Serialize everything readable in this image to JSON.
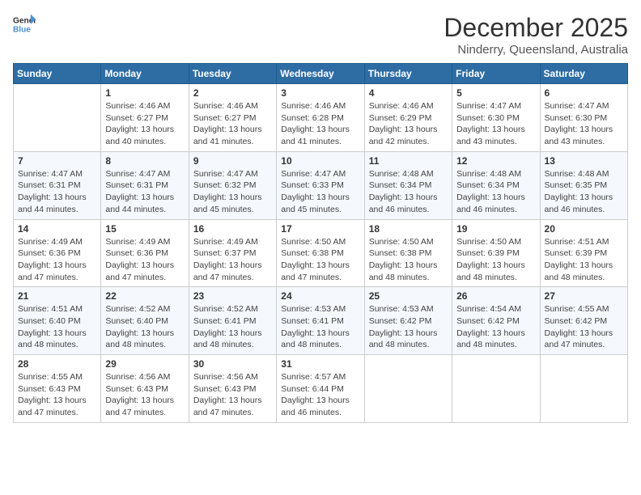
{
  "logo": {
    "text_general": "General",
    "text_blue": "Blue"
  },
  "header": {
    "title": "December 2025",
    "subtitle": "Ninderry, Queensland, Australia"
  },
  "weekdays": [
    "Sunday",
    "Monday",
    "Tuesday",
    "Wednesday",
    "Thursday",
    "Friday",
    "Saturday"
  ],
  "weeks": [
    [
      {
        "day": "",
        "sunrise": "",
        "sunset": "",
        "daylight": ""
      },
      {
        "day": "1",
        "sunrise": "Sunrise: 4:46 AM",
        "sunset": "Sunset: 6:27 PM",
        "daylight": "Daylight: 13 hours and 40 minutes."
      },
      {
        "day": "2",
        "sunrise": "Sunrise: 4:46 AM",
        "sunset": "Sunset: 6:27 PM",
        "daylight": "Daylight: 13 hours and 41 minutes."
      },
      {
        "day": "3",
        "sunrise": "Sunrise: 4:46 AM",
        "sunset": "Sunset: 6:28 PM",
        "daylight": "Daylight: 13 hours and 41 minutes."
      },
      {
        "day": "4",
        "sunrise": "Sunrise: 4:46 AM",
        "sunset": "Sunset: 6:29 PM",
        "daylight": "Daylight: 13 hours and 42 minutes."
      },
      {
        "day": "5",
        "sunrise": "Sunrise: 4:47 AM",
        "sunset": "Sunset: 6:30 PM",
        "daylight": "Daylight: 13 hours and 43 minutes."
      },
      {
        "day": "6",
        "sunrise": "Sunrise: 4:47 AM",
        "sunset": "Sunset: 6:30 PM",
        "daylight": "Daylight: 13 hours and 43 minutes."
      }
    ],
    [
      {
        "day": "7",
        "sunrise": "Sunrise: 4:47 AM",
        "sunset": "Sunset: 6:31 PM",
        "daylight": "Daylight: 13 hours and 44 minutes."
      },
      {
        "day": "8",
        "sunrise": "Sunrise: 4:47 AM",
        "sunset": "Sunset: 6:31 PM",
        "daylight": "Daylight: 13 hours and 44 minutes."
      },
      {
        "day": "9",
        "sunrise": "Sunrise: 4:47 AM",
        "sunset": "Sunset: 6:32 PM",
        "daylight": "Daylight: 13 hours and 45 minutes."
      },
      {
        "day": "10",
        "sunrise": "Sunrise: 4:47 AM",
        "sunset": "Sunset: 6:33 PM",
        "daylight": "Daylight: 13 hours and 45 minutes."
      },
      {
        "day": "11",
        "sunrise": "Sunrise: 4:48 AM",
        "sunset": "Sunset: 6:34 PM",
        "daylight": "Daylight: 13 hours and 46 minutes."
      },
      {
        "day": "12",
        "sunrise": "Sunrise: 4:48 AM",
        "sunset": "Sunset: 6:34 PM",
        "daylight": "Daylight: 13 hours and 46 minutes."
      },
      {
        "day": "13",
        "sunrise": "Sunrise: 4:48 AM",
        "sunset": "Sunset: 6:35 PM",
        "daylight": "Daylight: 13 hours and 46 minutes."
      }
    ],
    [
      {
        "day": "14",
        "sunrise": "Sunrise: 4:49 AM",
        "sunset": "Sunset: 6:36 PM",
        "daylight": "Daylight: 13 hours and 47 minutes."
      },
      {
        "day": "15",
        "sunrise": "Sunrise: 4:49 AM",
        "sunset": "Sunset: 6:36 PM",
        "daylight": "Daylight: 13 hours and 47 minutes."
      },
      {
        "day": "16",
        "sunrise": "Sunrise: 4:49 AM",
        "sunset": "Sunset: 6:37 PM",
        "daylight": "Daylight: 13 hours and 47 minutes."
      },
      {
        "day": "17",
        "sunrise": "Sunrise: 4:50 AM",
        "sunset": "Sunset: 6:38 PM",
        "daylight": "Daylight: 13 hours and 47 minutes."
      },
      {
        "day": "18",
        "sunrise": "Sunrise: 4:50 AM",
        "sunset": "Sunset: 6:38 PM",
        "daylight": "Daylight: 13 hours and 48 minutes."
      },
      {
        "day": "19",
        "sunrise": "Sunrise: 4:50 AM",
        "sunset": "Sunset: 6:39 PM",
        "daylight": "Daylight: 13 hours and 48 minutes."
      },
      {
        "day": "20",
        "sunrise": "Sunrise: 4:51 AM",
        "sunset": "Sunset: 6:39 PM",
        "daylight": "Daylight: 13 hours and 48 minutes."
      }
    ],
    [
      {
        "day": "21",
        "sunrise": "Sunrise: 4:51 AM",
        "sunset": "Sunset: 6:40 PM",
        "daylight": "Daylight: 13 hours and 48 minutes."
      },
      {
        "day": "22",
        "sunrise": "Sunrise: 4:52 AM",
        "sunset": "Sunset: 6:40 PM",
        "daylight": "Daylight: 13 hours and 48 minutes."
      },
      {
        "day": "23",
        "sunrise": "Sunrise: 4:52 AM",
        "sunset": "Sunset: 6:41 PM",
        "daylight": "Daylight: 13 hours and 48 minutes."
      },
      {
        "day": "24",
        "sunrise": "Sunrise: 4:53 AM",
        "sunset": "Sunset: 6:41 PM",
        "daylight": "Daylight: 13 hours and 48 minutes."
      },
      {
        "day": "25",
        "sunrise": "Sunrise: 4:53 AM",
        "sunset": "Sunset: 6:42 PM",
        "daylight": "Daylight: 13 hours and 48 minutes."
      },
      {
        "day": "26",
        "sunrise": "Sunrise: 4:54 AM",
        "sunset": "Sunset: 6:42 PM",
        "daylight": "Daylight: 13 hours and 48 minutes."
      },
      {
        "day": "27",
        "sunrise": "Sunrise: 4:55 AM",
        "sunset": "Sunset: 6:42 PM",
        "daylight": "Daylight: 13 hours and 47 minutes."
      }
    ],
    [
      {
        "day": "28",
        "sunrise": "Sunrise: 4:55 AM",
        "sunset": "Sunset: 6:43 PM",
        "daylight": "Daylight: 13 hours and 47 minutes."
      },
      {
        "day": "29",
        "sunrise": "Sunrise: 4:56 AM",
        "sunset": "Sunset: 6:43 PM",
        "daylight": "Daylight: 13 hours and 47 minutes."
      },
      {
        "day": "30",
        "sunrise": "Sunrise: 4:56 AM",
        "sunset": "Sunset: 6:43 PM",
        "daylight": "Daylight: 13 hours and 47 minutes."
      },
      {
        "day": "31",
        "sunrise": "Sunrise: 4:57 AM",
        "sunset": "Sunset: 6:44 PM",
        "daylight": "Daylight: 13 hours and 46 minutes."
      },
      {
        "day": "",
        "sunrise": "",
        "sunset": "",
        "daylight": ""
      },
      {
        "day": "",
        "sunrise": "",
        "sunset": "",
        "daylight": ""
      },
      {
        "day": "",
        "sunrise": "",
        "sunset": "",
        "daylight": ""
      }
    ]
  ]
}
